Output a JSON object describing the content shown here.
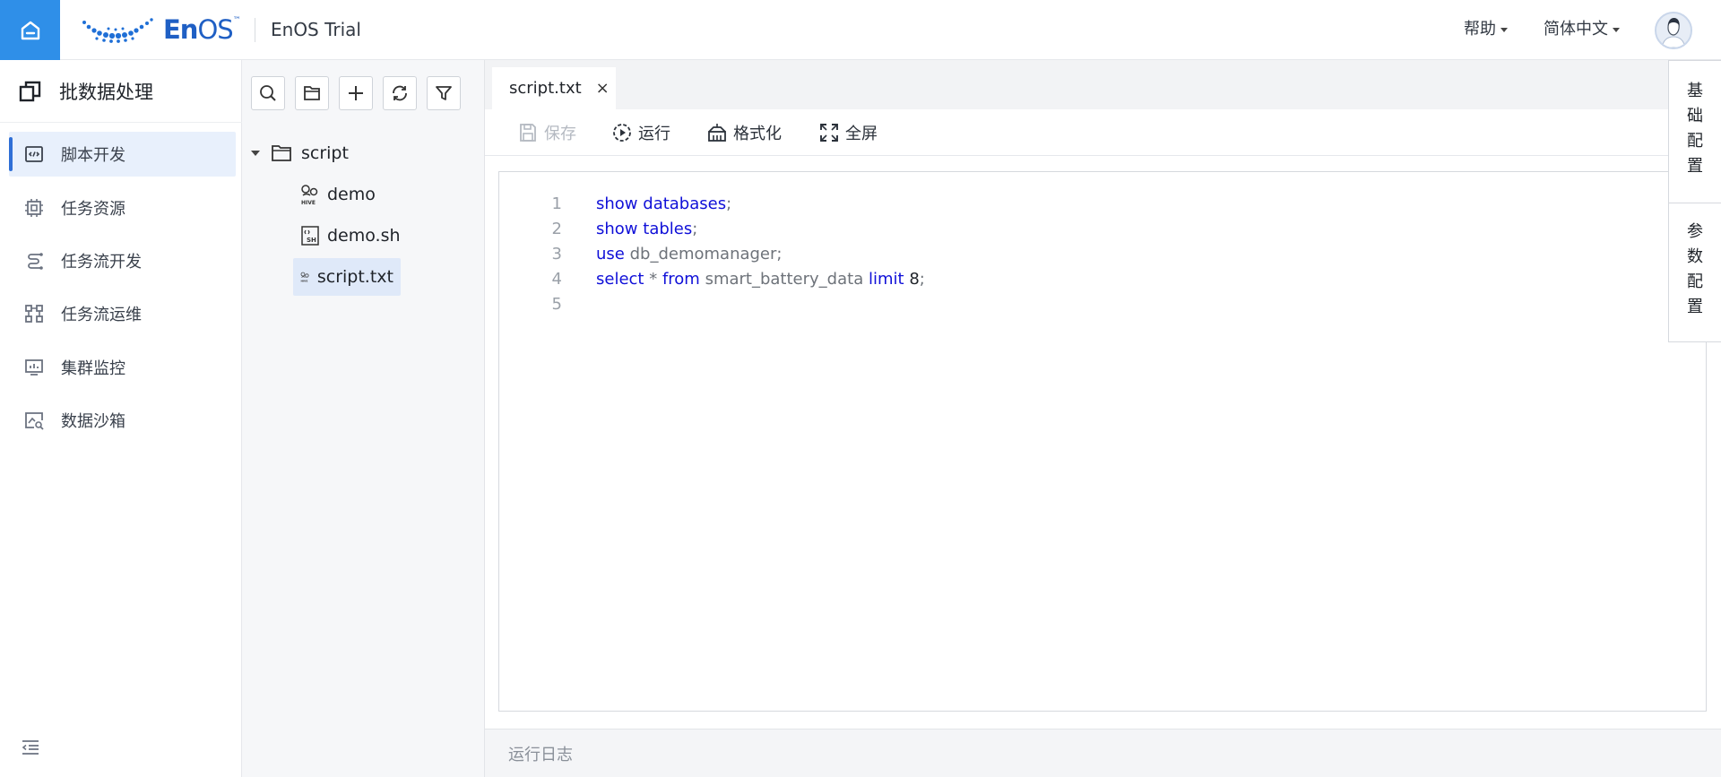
{
  "header": {
    "logo_text_bold": "En",
    "logo_text_light": "OS",
    "logo_tm": "™",
    "app_title": "EnOS Trial",
    "help_label": "帮助",
    "language_label": "简体中文"
  },
  "leftnav": {
    "module_title": "批数据处理",
    "items": [
      {
        "label": "脚本开发",
        "icon": "script-dev-icon",
        "active": true
      },
      {
        "label": "任务资源",
        "icon": "chip-icon",
        "active": false
      },
      {
        "label": "任务流开发",
        "icon": "flow-dev-icon",
        "active": false
      },
      {
        "label": "任务流运维",
        "icon": "flow-ops-icon",
        "active": false
      },
      {
        "label": "集群监控",
        "icon": "monitor-icon",
        "active": false
      },
      {
        "label": "数据沙箱",
        "icon": "sandbox-icon",
        "active": false
      }
    ]
  },
  "tree": {
    "folder": "script",
    "files": [
      {
        "name": "demo",
        "type": "hive"
      },
      {
        "name": "demo.sh",
        "type": "sh"
      },
      {
        "name": "script.txt",
        "type": "hive",
        "selected": true
      }
    ]
  },
  "editor": {
    "tab_label": "script.txt",
    "tab_close": "×",
    "toolbar": {
      "save": "保存",
      "run": "运行",
      "format": "格式化",
      "fullscreen": "全屏"
    },
    "lines": [
      {
        "n": "1",
        "kw1": "show",
        "kw2": "databases",
        "rest": ";"
      },
      {
        "n": "2",
        "kw1": "show",
        "kw2": "tables",
        "rest": ";"
      },
      {
        "n": "3",
        "kw1": "use",
        "id1": "db_demomanager",
        "rest": ";"
      },
      {
        "n": "4",
        "kw1": "select",
        "op": "*",
        "kw2": "from",
        "id1": "smart_battery_data",
        "kw3": "limit",
        "num": "8",
        "rest": ";"
      },
      {
        "n": "5"
      }
    ],
    "log_label": "运行日志"
  },
  "rightpanel": {
    "basic_config": [
      "基",
      "础",
      "配",
      "置"
    ],
    "param_config": [
      "参",
      "数",
      "配",
      "置"
    ]
  },
  "colors": {
    "accent": "#2f8fe8",
    "keyword": "#1010d8",
    "active_nav_bg": "#e8f0fc"
  }
}
